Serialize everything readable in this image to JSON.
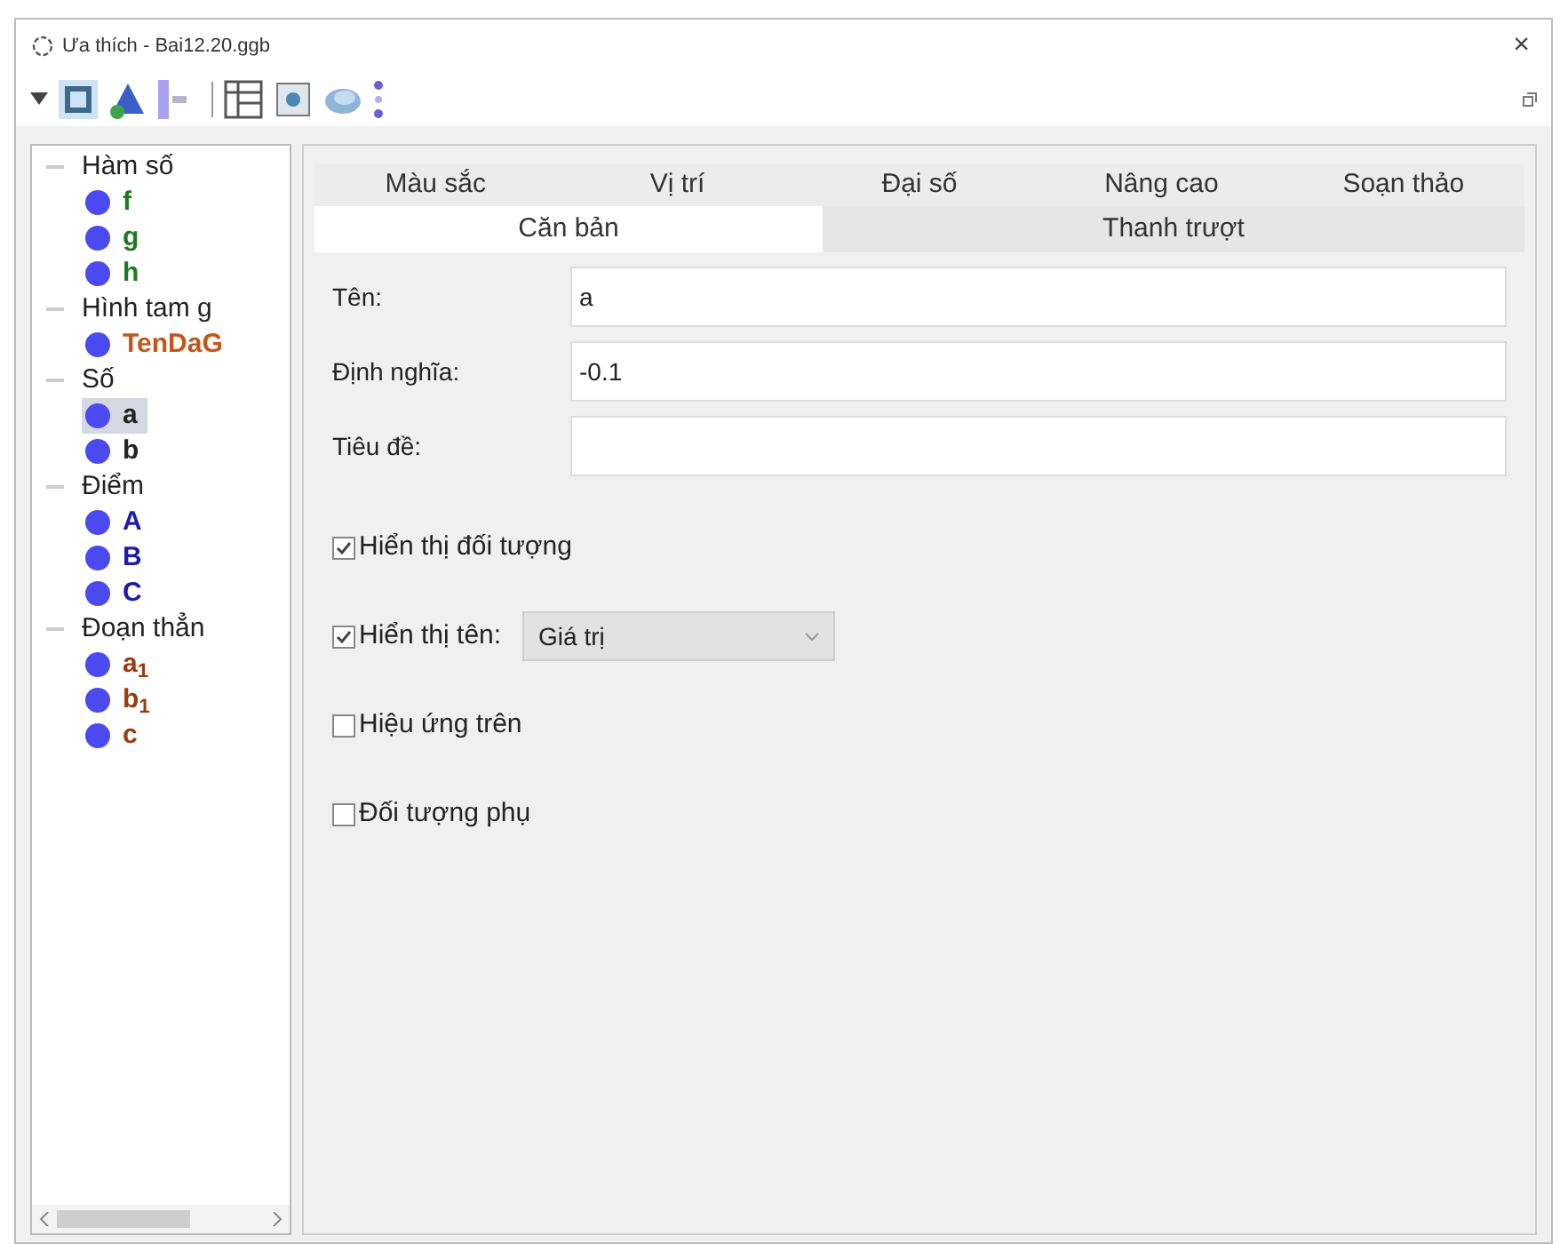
{
  "window": {
    "title": "Ưa thích - Bai12.20.ggb",
    "close": "×"
  },
  "tree": [
    {
      "label": "Hàm số",
      "expanded": true,
      "children": [
        {
          "label": "f",
          "color": "#1f7a1f",
          "selected": false
        },
        {
          "label": "g",
          "color": "#1f7a1f",
          "selected": false
        },
        {
          "label": "h",
          "color": "#1f7a1f",
          "selected": false
        }
      ]
    },
    {
      "label": "Hình tam g",
      "expanded": true,
      "children": [
        {
          "label": "TenDaG",
          "color": "#c4561a",
          "selected": false
        }
      ]
    },
    {
      "label": "Số",
      "expanded": true,
      "children": [
        {
          "label": "a",
          "color": "#222222",
          "selected": true
        },
        {
          "label": "b",
          "color": "#222222",
          "selected": false
        }
      ]
    },
    {
      "label": "Điểm",
      "expanded": true,
      "children": [
        {
          "label": "A",
          "color": "#1c1ca8",
          "selected": false
        },
        {
          "label": "B",
          "color": "#1c1ca8",
          "selected": false
        },
        {
          "label": "C",
          "color": "#1c1ca8",
          "selected": false
        }
      ]
    },
    {
      "label": "Đoạn thẳn",
      "expanded": true,
      "children": [
        {
          "label": "a$_{1}$",
          "color": "#9a3c10",
          "selected": false
        },
        {
          "label": "b$_{1}$",
          "color": "#9a3c10",
          "selected": false
        },
        {
          "label": "c",
          "color": "#9a3c10",
          "selected": false
        }
      ]
    }
  ],
  "tabs_top": [
    {
      "label": "Màu sắc",
      "selected": false
    },
    {
      "label": "Vị trí",
      "selected": false
    },
    {
      "label": "Đại số",
      "selected": false
    },
    {
      "label": "Nâng cao",
      "selected": false
    },
    {
      "label": "Soạn thảo",
      "selected": false
    }
  ],
  "tabs_bottom": [
    {
      "label": "Căn bản",
      "selected": true
    },
    {
      "label": "Thanh trượt",
      "selected": false
    }
  ],
  "fields": [
    {
      "label": "Tên:",
      "value": "a"
    },
    {
      "label": "Định nghĩa:",
      "value": "-0.1"
    },
    {
      "label": "Tiêu đề:"
    }
  ],
  "options": [
    {
      "label": "Hiển thị đối tượng",
      "checked": true
    },
    {
      "label": "Hiển thị tên:",
      "checked": true,
      "dropdown": "Giá trị"
    },
    {
      "label": "Hiệu ứng trên",
      "checked": false
    },
    {
      "label": "Đối tượng phụ",
      "checked": false
    }
  ]
}
